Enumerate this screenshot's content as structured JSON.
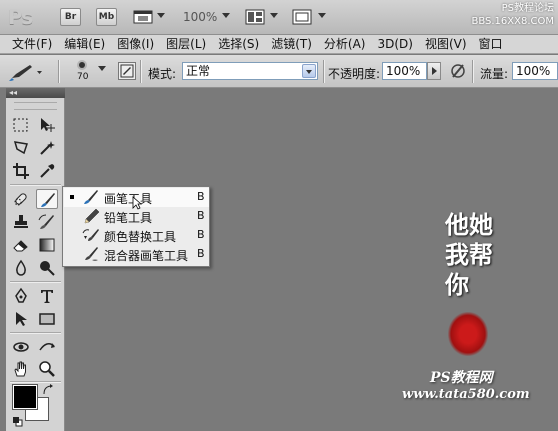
{
  "appbar": {
    "logo": "Ps",
    "bridge_label": "Br",
    "minibridge_label": "Mb",
    "zoom": "100%",
    "watermark_title": "PS教程论坛",
    "watermark_url": "BBS.16XX8.COM"
  },
  "menu": [
    {
      "label": "文件(F)"
    },
    {
      "label": "编辑(E)"
    },
    {
      "label": "图像(I)"
    },
    {
      "label": "图层(L)"
    },
    {
      "label": "选择(S)"
    },
    {
      "label": "滤镜(T)"
    },
    {
      "label": "分析(A)"
    },
    {
      "label": "3D(D)"
    },
    {
      "label": "视图(V)"
    },
    {
      "label": "窗口"
    }
  ],
  "options": {
    "brush_size": "70",
    "mode_label": "模式:",
    "mode_value": "正常",
    "opacity_label": "不透明度:",
    "opacity_value": "100%",
    "flow_label": "流量:",
    "flow_value": "100%"
  },
  "flyout": {
    "items": [
      {
        "label": "画笔工具",
        "key": "B",
        "icon": "brush-icon",
        "selected": true
      },
      {
        "label": "铅笔工具",
        "key": "B",
        "icon": "pencil-icon",
        "selected": false
      },
      {
        "label": "颜色替换工具",
        "key": "B",
        "icon": "color-replacement-icon",
        "selected": false
      },
      {
        "label": "混合器画笔工具",
        "key": "B",
        "icon": "mixer-brush-icon",
        "selected": false
      }
    ]
  },
  "watermark": {
    "calligraphy": "他她我帮你",
    "site_name": "PS教程网",
    "site_url": "www.tata580.com"
  },
  "colors": {
    "canvas_bg": "#7a7a7a",
    "foreground": "#000000",
    "background": "#ffffff",
    "seal_red": "#cc1a1a"
  }
}
